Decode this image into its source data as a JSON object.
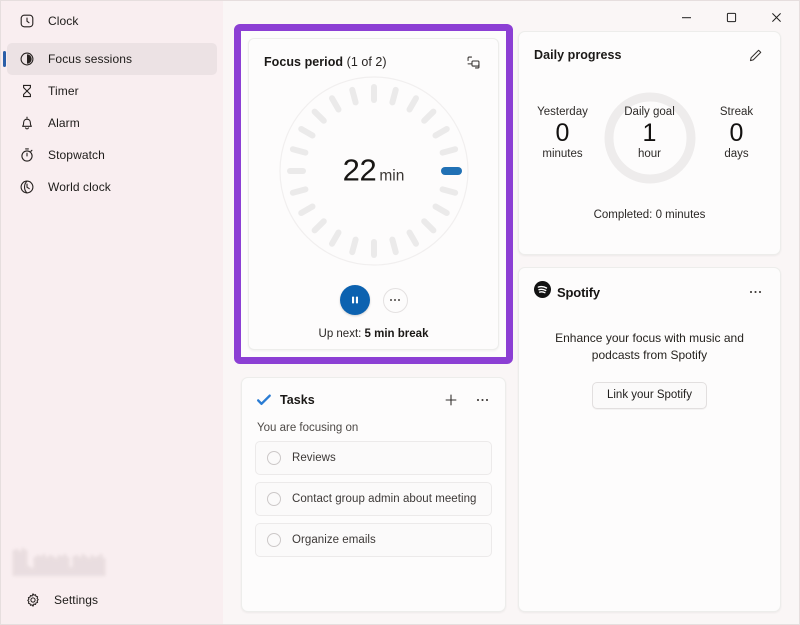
{
  "app": {
    "title": "Clock"
  },
  "titlebar": {
    "minimize": "minimize-button",
    "maximize": "maximize-button",
    "close": "close-button"
  },
  "sidebar": {
    "items": [
      {
        "label": "Clock",
        "icon": "clock-icon",
        "selected": false
      },
      {
        "label": "Focus sessions",
        "icon": "focus-sessions-icon",
        "selected": true
      },
      {
        "label": "Timer",
        "icon": "hourglass-icon",
        "selected": false
      },
      {
        "label": "Alarm",
        "icon": "bell-icon",
        "selected": false
      },
      {
        "label": "Stopwatch",
        "icon": "stopwatch-icon",
        "selected": false
      },
      {
        "label": "World clock",
        "icon": "globe-clock-icon",
        "selected": false
      }
    ],
    "settings": {
      "label": "Settings",
      "icon": "gear-icon"
    }
  },
  "focus_period": {
    "title": "Focus period",
    "subtitle": "(1 of 2)",
    "compact_view_icon": "compact-view-icon",
    "timer": {
      "minutes": "22",
      "unit": "min",
      "tick_count": 24,
      "active_tick_index": 6,
      "tick_color": "#ebeaea",
      "active_tick_color": "#2171b5"
    },
    "pause_label": "pause-button",
    "more_label": "•••",
    "up_next_prefix": "Up next:",
    "up_next_value": "5 min break",
    "highlight_color": "#8c3fd4"
  },
  "tasks": {
    "title": "Tasks",
    "icon": "microsoft-todo-icon",
    "add_label": "+",
    "more_label": "•••",
    "subtitle": "You are focusing on",
    "items": [
      {
        "label": "Reviews",
        "done": false
      },
      {
        "label": "Contact group admin about meeting",
        "done": false
      },
      {
        "label": "Organize emails",
        "done": false
      }
    ]
  },
  "daily_progress": {
    "title": "Daily progress",
    "edit_icon": "pencil-icon",
    "stats": [
      {
        "name": "Yesterday",
        "value": "0",
        "unit": "minutes"
      },
      {
        "name": "Daily goal",
        "value": "1",
        "unit": "hour"
      },
      {
        "name": "Streak",
        "value": "0",
        "unit": "days"
      }
    ],
    "completed": "Completed: 0 minutes",
    "ring_progress_percent": 0
  },
  "spotify": {
    "name": "Spotify",
    "icon": "spotify-logo-icon",
    "more_label": "•••",
    "description": "Enhance your focus with music and podcasts from Spotify",
    "link_button": "Link your Spotify",
    "brand_color": "#121212"
  }
}
